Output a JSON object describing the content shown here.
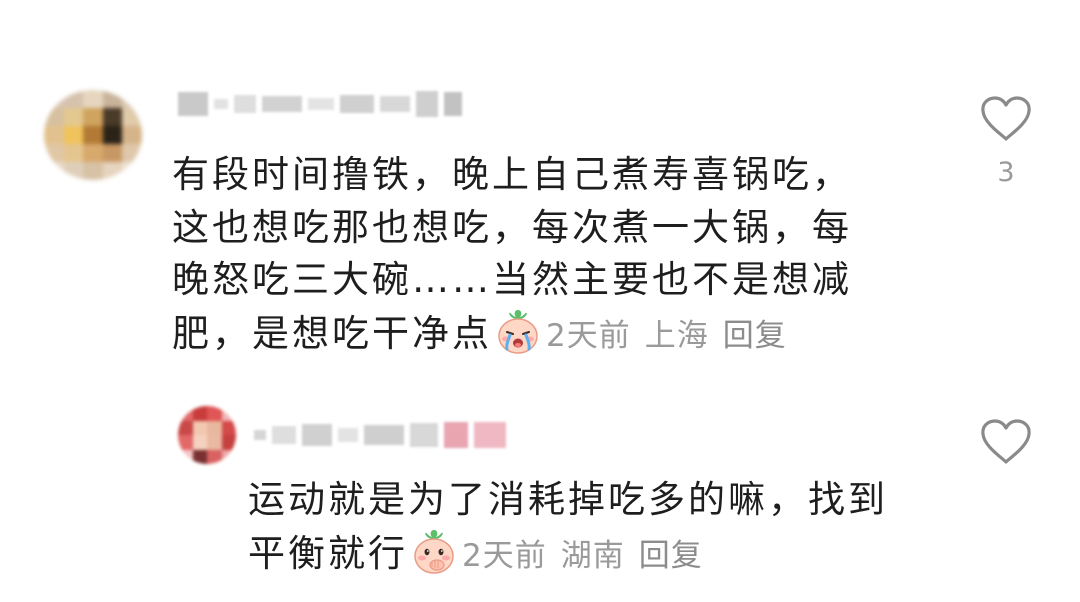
{
  "comments": [
    {
      "author_name": "",
      "text_lines": [
        "有段时间撸铁，晚上自己煮寿喜锅吃，",
        "这也想吃那也想吃，每次煮一大锅，每",
        "晚怒吃三大碗……当然主要也不是想减",
        "肥，是想吃干净点"
      ],
      "emoji": "crying-face-emoji",
      "time": "2天前",
      "location": "上海",
      "reply_label": "回复",
      "like_count": "3",
      "like_icon": "heart-outline-icon"
    },
    {
      "author_name": "",
      "text_lines": [
        "运动就是为了消耗掉吃多的嘛，找到",
        "平衡就行"
      ],
      "emoji": "giggle-face-emoji",
      "time": "2天前",
      "location": "湖南",
      "reply_label": "回复",
      "like_count": "",
      "like_icon": "heart-outline-icon"
    }
  ],
  "colors": {
    "text": "#1e1e1e",
    "meta": "#9a9a9a",
    "icon": "#8a8a8a"
  }
}
